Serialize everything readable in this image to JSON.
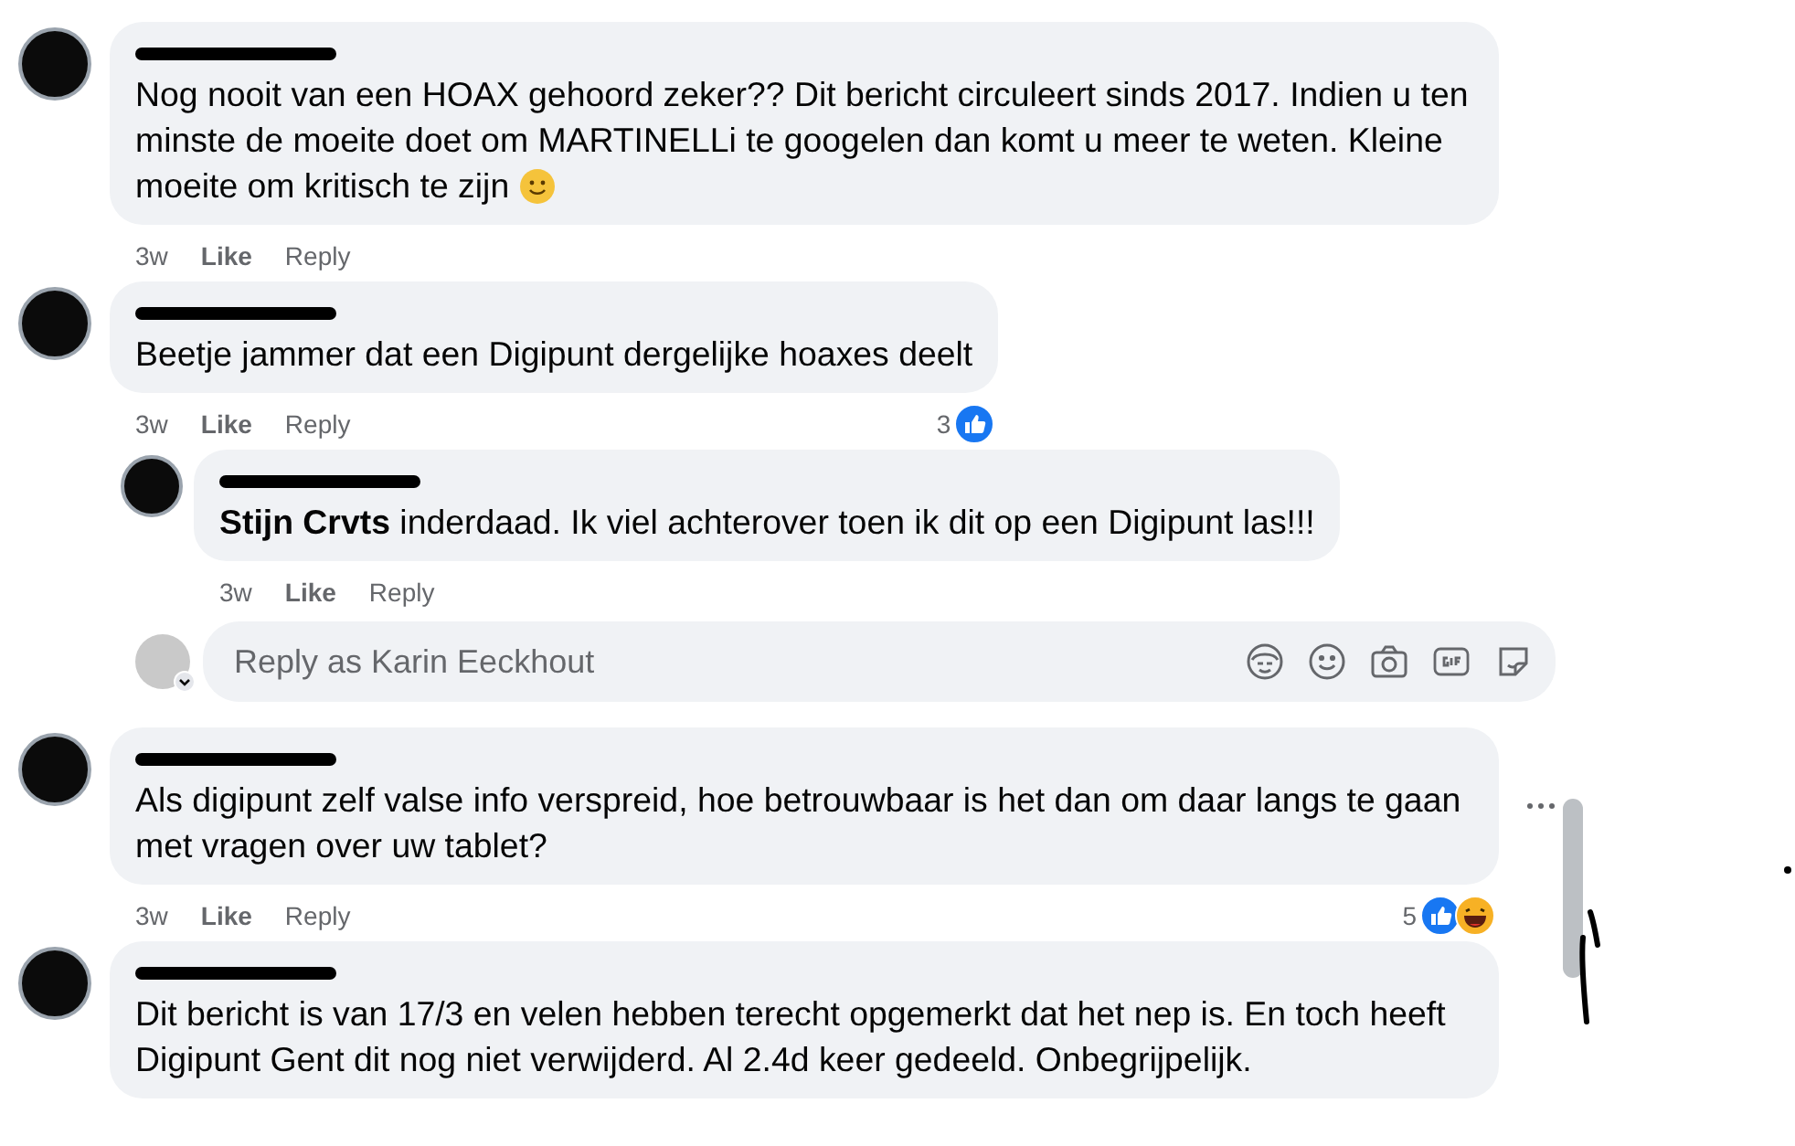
{
  "comments": [
    {
      "text": "Nog nooit van een HOAX gehoord zeker?? Dit bericht circuleert sinds 2017. Indien u ten minste de moeite doet om MARTINELLi te googelen dan komt u meer te weten. Kleine moeite om kritisch te zijn",
      "has_smiley": true,
      "time": "3w",
      "like": "Like",
      "reply": "Reply",
      "show_menu": false
    },
    {
      "text": "Beetje jammer dat een Digipunt dergelijke hoaxes deelt",
      "time": "3w",
      "like": "Like",
      "reply": "Reply",
      "show_menu": false,
      "reaction_count": "3",
      "reactions": [
        {
          "kind": "like"
        }
      ],
      "replies": [
        {
          "text": "**Stijn Crvts** inderdaad. Ik viel achterover toen ik dit op een Digipunt las!!!",
          "time": "3w",
          "like": "Like",
          "reply": "Reply",
          "show_menu": false
        }
      ],
      "reply_box": {
        "placeholder": "Reply as Karin Eeckhout"
      }
    },
    {
      "text": "Als digipunt zelf valse info verspreid, hoe betrouwbaar is het dan om daar langs te gaan met vragen over uw tablet?",
      "time": "3w",
      "like": "Like",
      "reply": "Reply",
      "show_menu": true,
      "reaction_count": "5",
      "reactions": [
        {
          "kind": "like"
        },
        {
          "kind": "haha"
        }
      ]
    },
    {
      "text": "Dit bericht is van 17/3 en velen hebben terecht opgemerkt dat het nep is. En toch heeft Digipunt Gent dit nog niet verwijderd. Al 2.4d keer gedeeld. Onbegrijpelijk.",
      "show_menu": false
    }
  ]
}
